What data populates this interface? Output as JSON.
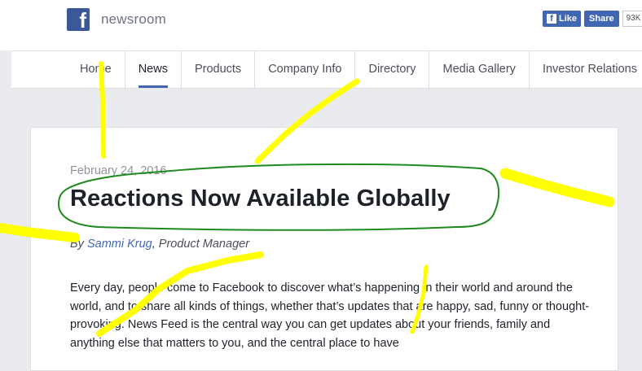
{
  "header": {
    "logo_letter": "f",
    "brand": "newsroom",
    "like_label": "Like",
    "like_letter": "f",
    "share_label": "Share",
    "share_count": "93K"
  },
  "nav": {
    "items": [
      "Home",
      "News",
      "Products",
      "Company Info",
      "Directory",
      "Media Gallery",
      "Investor Relations"
    ],
    "active": "News"
  },
  "article": {
    "date": "February 24, 2016",
    "title": "Reactions Now Available Globally",
    "by_prefix": "By",
    "author": "Sammi Krug",
    "author_role": ", Product Manager",
    "body": "Every day, people come to Facebook to discover what’s happening in their world and around the world, and to share all kinds of things, whether that’s updates that are happy, sad, funny or thought-provoking. News Feed is the central way you can get updates about your friends, family and anything else that matters to you, and the central place to have"
  },
  "colors": {
    "highlighter": "#ffff00",
    "circle": "#1e8a1e",
    "brand_blue": "#3b5998"
  }
}
